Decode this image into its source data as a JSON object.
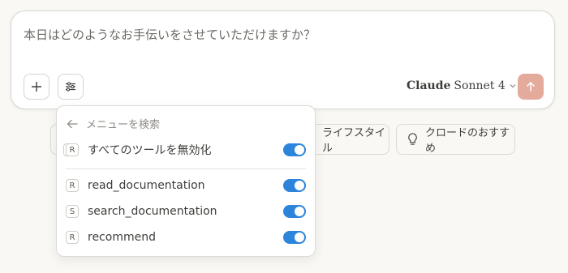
{
  "composer": {
    "placeholder": "本日はどのようなお手伝いをさせていただけますか？",
    "model_brand": "Claude",
    "model_version": "Sonnet 4",
    "send_color": "#e4ab9c"
  },
  "chips": [
    {
      "label": "ライフスタイル",
      "icon": "arrow-icon"
    },
    {
      "label": "クロードのおすすめ",
      "icon": "lightbulb-icon"
    }
  ],
  "tools_menu": {
    "search_placeholder": "メニューを検索",
    "disable_all": {
      "badge": "R",
      "label": "すべてのツールを無効化",
      "enabled": true
    },
    "tools": [
      {
        "badge": "R",
        "label": "read_documentation",
        "enabled": true
      },
      {
        "badge": "S",
        "label": "search_documentation",
        "enabled": true
      },
      {
        "badge": "R",
        "label": "recommend",
        "enabled": true
      }
    ],
    "toggle_color": "#2c84db"
  }
}
